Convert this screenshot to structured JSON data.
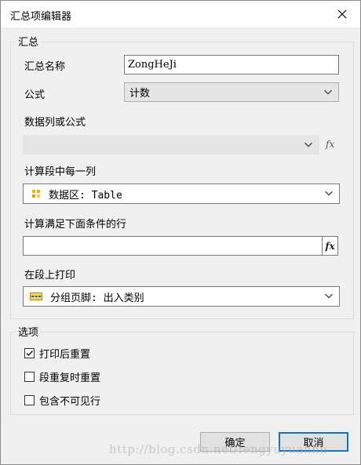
{
  "window": {
    "title": "汇总项编辑器",
    "close_icon": "close-icon"
  },
  "summary_group": {
    "label": "汇总",
    "name_label": "汇总名称",
    "name_value": "ZongHeJi",
    "formula_label": "公式",
    "formula_value": "计数",
    "column_label": "数据列或公式",
    "column_value": "",
    "segment_label": "计算段中每一列",
    "segment_value": "数据区: Table",
    "condition_label": "计算满足下面条件的行",
    "condition_value": "",
    "print_label": "在段上打印",
    "print_value": "分组页脚: 出入类别",
    "fx_label": "fx"
  },
  "options_group": {
    "label": "选项",
    "checkboxes": [
      {
        "label": "打印后重置",
        "checked": true
      },
      {
        "label": "段重复时重置",
        "checked": false
      },
      {
        "label": "包含不可见行",
        "checked": false
      }
    ]
  },
  "buttons": {
    "ok": "确定",
    "cancel": "取消"
  },
  "watermark": "http://blog.csdn.net/fengyuyuanhu",
  "colors": {
    "accent": "#0078d7",
    "dialog_bg": "#f0f0f0"
  }
}
